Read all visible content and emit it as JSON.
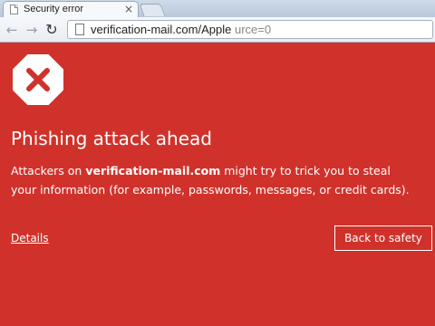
{
  "browser": {
    "tab_title": "Security error",
    "tab_close": "×",
    "nav": {
      "back": "←",
      "forward": "→",
      "reload": "↻"
    },
    "url": {
      "host": "verification-mail.com",
      "path": "/Apple",
      "rest": "urce=0"
    }
  },
  "interstitial": {
    "background_color": "#d0322b",
    "icon": "stop-x-icon",
    "heading": "Phishing attack ahead",
    "message_prefix": "Attackers on ",
    "message_host": "verification-mail.com",
    "message_suffix": " might try to trick you to steal your information (for example, passwords, messages, or credit cards).",
    "details_link": "Details",
    "safety_button": "Back to safety"
  }
}
